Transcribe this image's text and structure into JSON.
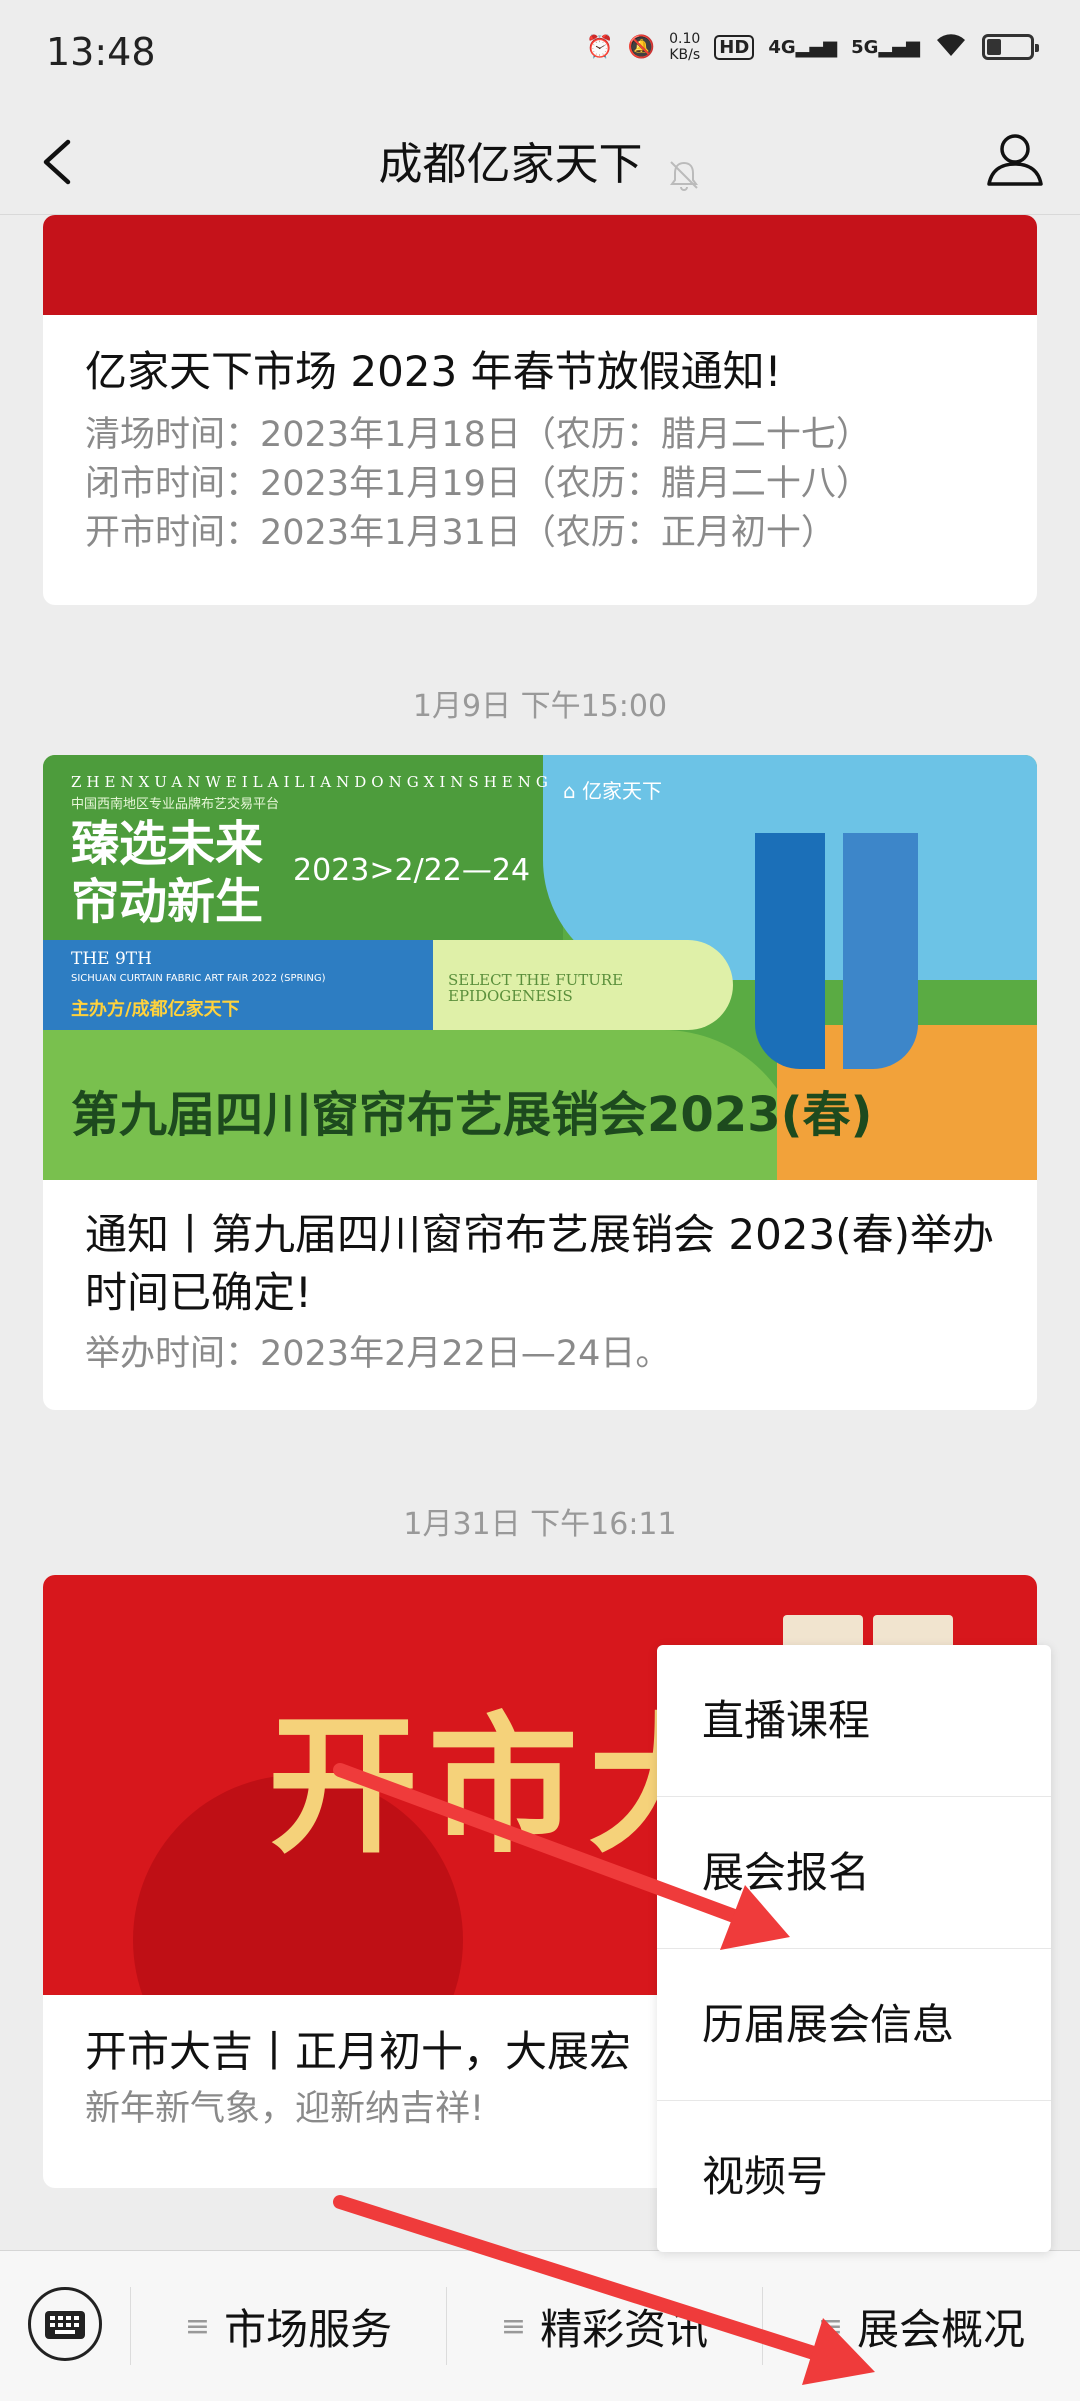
{
  "status": {
    "time": "13:48",
    "net_speed_value": "0.10",
    "net_speed_unit": "KB/s",
    "hd": "HD",
    "sig1": "4G",
    "sig2": "5G"
  },
  "nav": {
    "title": "成都亿家天下"
  },
  "cards": [
    {
      "title": "亿家天下市场 2023 年春节放假通知!",
      "lines": [
        "清场时间：2023年1月18日（农历：腊月二十七）",
        "闭市时间：2023年1月19日（农历：腊月二十八）",
        "开市时间：2023年1月31日（农历：正月初十）"
      ]
    },
    {
      "timestamp": "1月9日 下午15:00",
      "banner": {
        "pinyin": "ZHENXUANWEILAILIANDONGXINSHENG",
        "sub": "中国西南地区专业品牌布艺交易平台",
        "slogan1": "臻选未来",
        "slogan2": "帘动新生",
        "date": "2023>2/22—24",
        "en1": "THE 9TH",
        "en2": "SICHUAN CURTAIN FABRIC ART FAIR 2022 (SPRING)",
        "host": "主办方/成都亿家天下",
        "select1": "SELECT THE FUTURE",
        "select2": "EPIDOGENESIS",
        "logo": "亿家天下",
        "big": "第九届四川窗帘布艺展销会2023(春)"
      },
      "title": "通知丨第九届四川窗帘布艺展销会 2023(春)举办时间已确定!",
      "lines": [
        "举办时间：2023年2月22日—24日。"
      ]
    },
    {
      "timestamp": "1月31日 下午16:11",
      "banner": {
        "text": "开市大"
      },
      "title": "开市大吉丨正月初十，大展宏",
      "lines": [
        "新年新气象，迎新纳吉祥!"
      ]
    }
  ],
  "popup_menu": [
    "直播课程",
    "展会报名",
    "历届展会信息",
    "视频号"
  ],
  "bottom_menu": [
    "市场服务",
    "精彩资讯",
    "展会概况"
  ],
  "colors": {
    "background": "#ededed",
    "annotation_arrow": "#ef3b3b",
    "banner_red": "#d7171c"
  }
}
